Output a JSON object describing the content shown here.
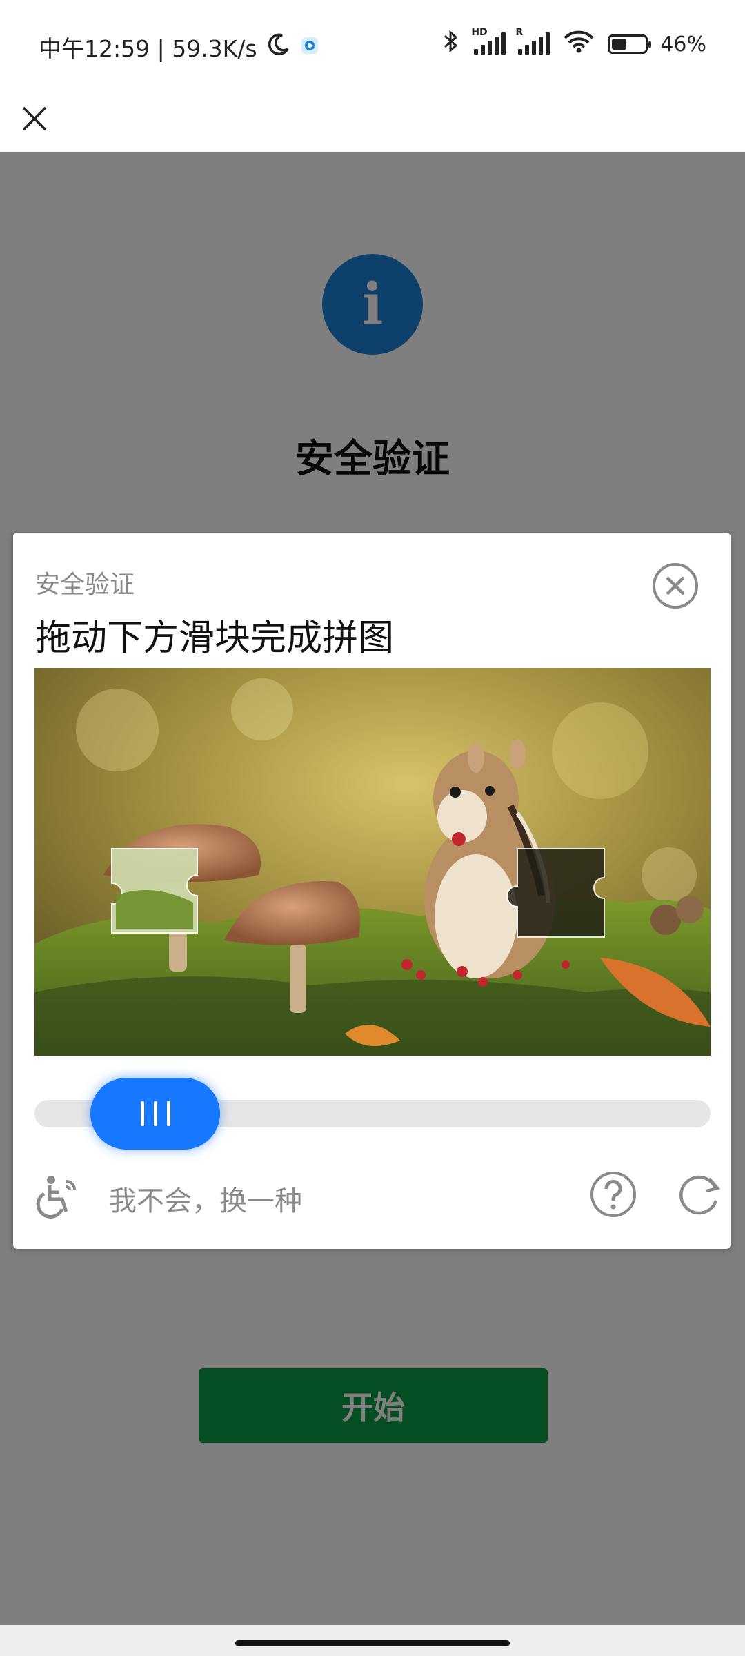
{
  "status_bar": {
    "time_speed": "中午12:59 | 59.3K/s",
    "battery_level": "46%",
    "battery_fill_fraction": 0.46,
    "icons": [
      "moon-icon",
      "app-notification-icon",
      "bluetooth-icon",
      "signal-hd-icon",
      "signal-r-icon",
      "wifi-icon",
      "battery-icon"
    ],
    "signal_tag_1": "HD",
    "signal_tag_2": "R"
  },
  "page": {
    "title": "安全验证",
    "start_button": "开始",
    "accent_color": "#1a82d6",
    "button_color": "#0a9a46"
  },
  "captcha": {
    "label": "安全验证",
    "instruction": "拖动下方滑块完成拼图",
    "switch_link": "我不会，换一种",
    "slider_color": "#1677ff",
    "slider_progress": 0.0,
    "image_description_icon": "chipmunk-mushrooms-image"
  }
}
